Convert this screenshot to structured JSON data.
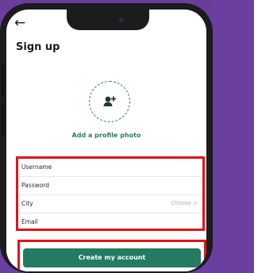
{
  "header": {
    "back_icon": "arrow-left-icon",
    "title": "Sign up"
  },
  "profile": {
    "icon": "add-user-icon",
    "label": "Add a profile photo"
  },
  "form": {
    "fields": [
      {
        "label": "Username",
        "hint": ""
      },
      {
        "label": "Password",
        "hint": ""
      },
      {
        "label": "City",
        "hint": "Choose >"
      },
      {
        "label": "Email",
        "hint": ""
      }
    ]
  },
  "actions": {
    "create_label": "Create my account"
  },
  "colors": {
    "accent": "#247b62",
    "highlight": "#e0141b",
    "background": "#6b3fa0"
  }
}
